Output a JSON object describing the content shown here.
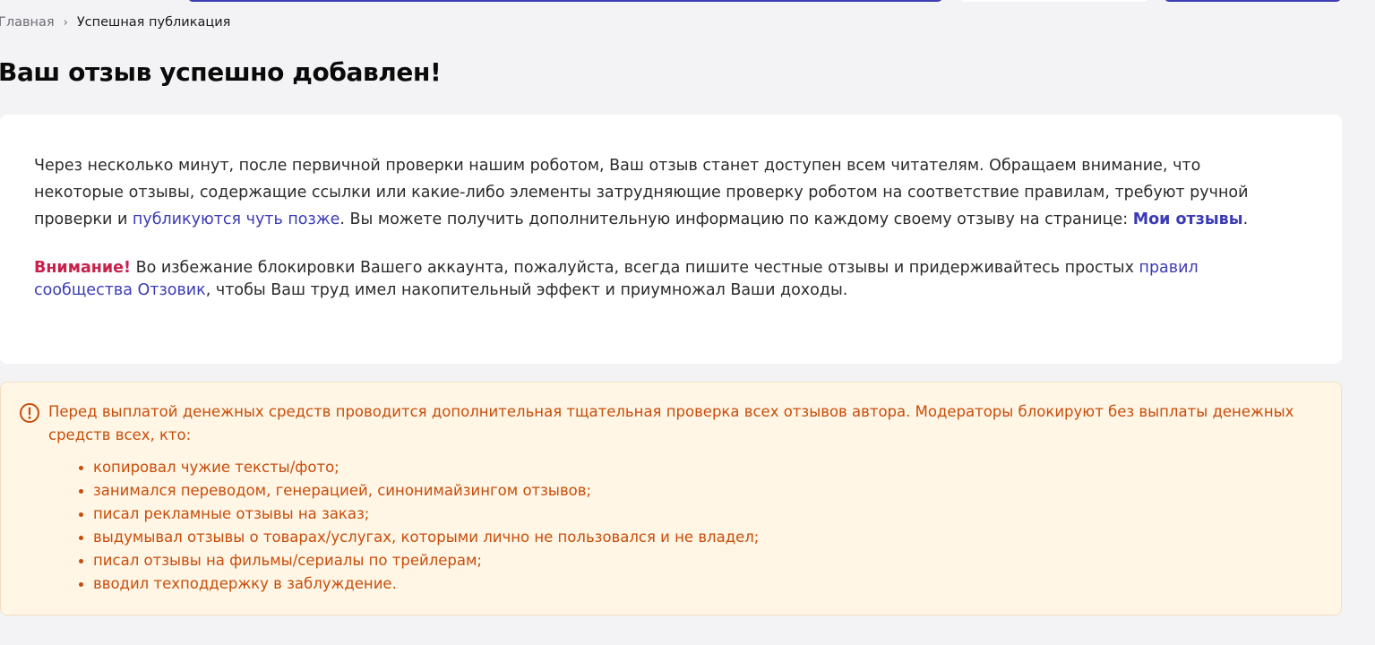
{
  "breadcrumb": {
    "home": "Главная",
    "separator": "›",
    "current": "Успешная публикация"
  },
  "page": {
    "title": "Ваш отзыв успешно добавлен!"
  },
  "info_card": {
    "paragraph1": {
      "text_before_link": "Через несколько минут, после первичной проверки нашим роботом, Ваш отзыв станет доступен всем читателям. Обращаем внимание, что некоторые отзывы, содержащие ссылки или какие-либо элементы затрудняющие проверку роботом на соответствие правилам, требуют ручной проверки и ",
      "link_later": "публикуются чуть позже",
      "text_middle": ". Вы можете получить дополнительную информацию по каждому своему отзыву на странице: ",
      "link_my_reviews": "Мои отзывы",
      "text_end": "."
    },
    "paragraph2": {
      "warning_word": "Внимание!",
      "text_before_link": " Во избежание блокировки Вашего аккаунта, пожалуйста, всегда пишите честные отзывы и придерживайтесь простых ",
      "link_rules": "правил сообщества Отзовик",
      "text_end": ", чтобы Ваш труд имел накопительный эффект и приумножал Ваши доходы."
    }
  },
  "notice": {
    "icon": "exclamation-circle-icon",
    "text": "Перед выплатой денежных средств проводится дополнительная тщательная проверка всех отзывов автора. Модераторы блокируют без выплаты денежных средств всех, кто:",
    "items": [
      "копировал чужие тексты/фото;",
      "занимался переводом, генерацией, синонимайзингом отзывов;",
      "писал рекламные отзывы на заказ;",
      "выдумывал отзывы о товарах/услугах, которыми лично не пользовался и не владел;",
      "писал отзывы на фильмы/сериалы по трейлерам;",
      "вводил техподдержку в заблуждение."
    ]
  },
  "colors": {
    "background": "#f3f3f6",
    "accent": "#3b3bb5",
    "warning": "#c8214c",
    "notice_text": "#c84d0a",
    "notice_bg": "#fff6e6"
  }
}
